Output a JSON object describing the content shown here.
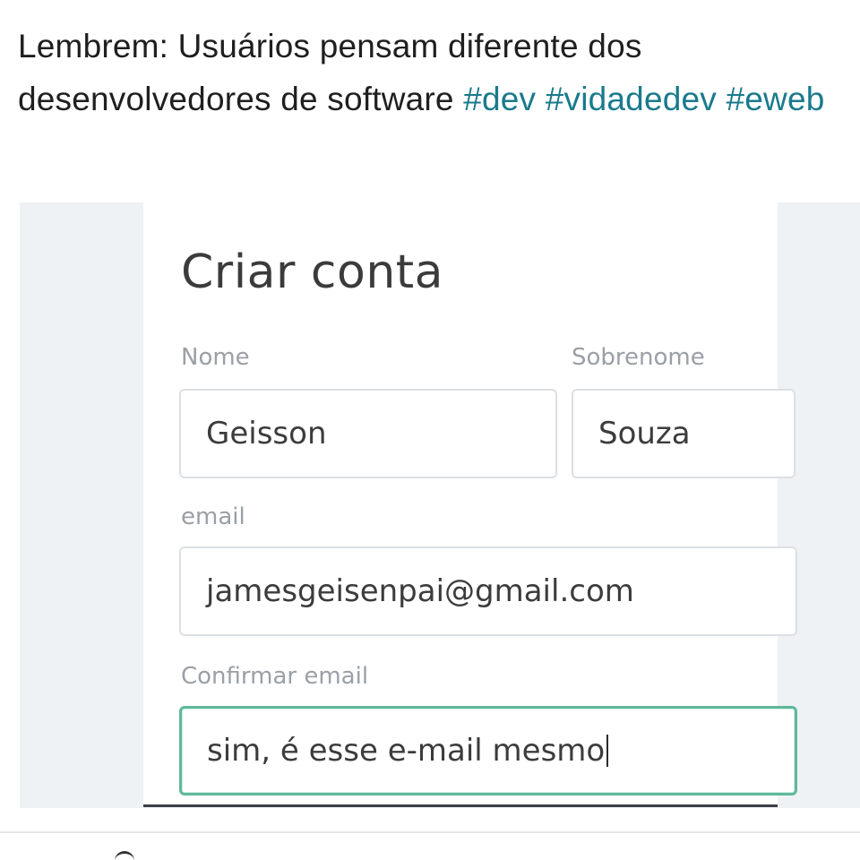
{
  "post": {
    "caption_text": "Lembrem: Usuários pensam diferente dos desenvolvedores de software",
    "hashtags": [
      "#dev",
      "#vidadedev",
      "#eweb"
    ],
    "hashtag_color": "#1a7a8c"
  },
  "form": {
    "title": "Criar conta",
    "first_name": {
      "label": "Nome",
      "value": "Geisson"
    },
    "last_name": {
      "label": "Sobrenome",
      "value": "Souza"
    },
    "email": {
      "label": "email",
      "value": "jamesgeisenpai@gmail.com"
    },
    "confirm_email": {
      "label": "Confirmar email",
      "value": "sim, é esse e-mail mesmo",
      "focus_color": "#5fb89a"
    }
  },
  "icons": {
    "bottom_action": "heart-icon"
  }
}
